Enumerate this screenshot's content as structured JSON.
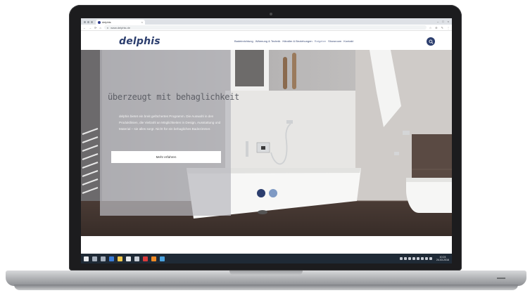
{
  "browser": {
    "tab_title": "delphis",
    "tab_close": "×",
    "window_controls": [
      "–",
      "□",
      "×"
    ],
    "nav_back": "←",
    "nav_forward": "→",
    "nav_reload": "⟳",
    "nav_home": "⌂",
    "address": "www.delphis.de",
    "extensions": [
      "☆",
      "⊕",
      "✎",
      "⋮"
    ]
  },
  "site": {
    "logo": "delphis",
    "nav": [
      {
        "label": "Badeinrichtung"
      },
      {
        "label": "Wärmung & Technik"
      },
      {
        "label": "Händler & Beziehungen"
      },
      {
        "label": "Ratgeber"
      },
      {
        "label": "Showroom"
      },
      {
        "label": "Kontakt"
      }
    ],
    "search_icon": "search-icon"
  },
  "hero": {
    "title": "überzeugt mit behaglichkeit",
    "text": "delphis bietet ein breit gefächertes Programm. Die Auswahl in den Produktlinien, die Vielzahl an Möglichkeiten in Design, Ausstattung und Material – sie alles sorgt. Nicht für ein behagliches Badezimmer.",
    "cta_label": "Mehr erfahren",
    "slides": {
      "current": 1,
      "total": 2
    }
  },
  "taskbar": {
    "clock_time": "10:24",
    "clock_date": "24.03.2016"
  },
  "colors": {
    "brand": "#2c3e6e",
    "overlay": "#b9b9be",
    "taskbar": "#1f2a36"
  }
}
